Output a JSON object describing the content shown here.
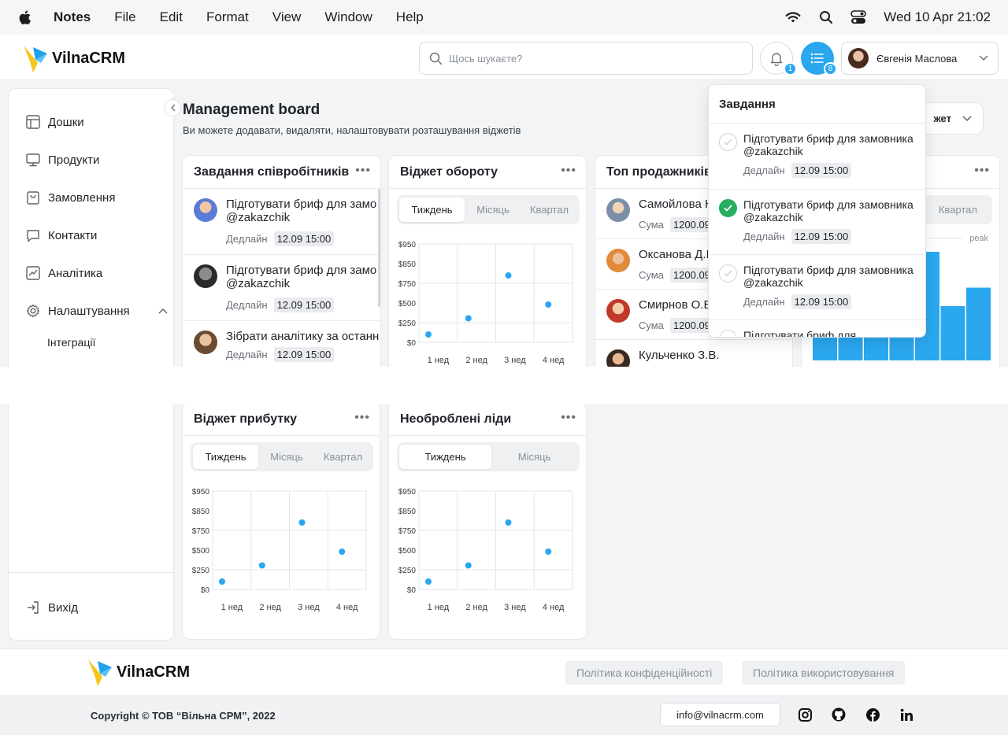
{
  "menubar": {
    "app": "Notes",
    "items": [
      "File",
      "Edit",
      "Format",
      "View",
      "Window",
      "Help"
    ],
    "datetime": "Wed 10 Apr  21:02"
  },
  "header": {
    "logo_text": "VilnaCRM",
    "search_placeholder": "Щось шукаєте?",
    "notifications_count": "1",
    "tasks_count": "8",
    "user_name": "Євгенія Маслова"
  },
  "sidebar": {
    "items": [
      {
        "label": "Дошки",
        "icon": "board-icon"
      },
      {
        "label": "Продукти",
        "icon": "monitor-icon"
      },
      {
        "label": "Замовлення",
        "icon": "shopping-bag-icon"
      },
      {
        "label": "Контакти",
        "icon": "chat-icon"
      },
      {
        "label": "Аналітика",
        "icon": "chart-icon"
      },
      {
        "label": "Налаштування",
        "icon": "gear-icon"
      }
    ],
    "sub_item": "Інтеграції",
    "logout": "Вихід"
  },
  "page": {
    "title": "Management board",
    "subtitle": "Ви можете додавати, видаляти, налаштовувати розташування віджетів",
    "add_widget_label": "жет"
  },
  "employee_tasks": {
    "title": "Завдання співробітників",
    "tasks": [
      {
        "text": "Підготувати бриф для замо",
        "handle": "@zakazchik",
        "deadline_label": "Дедлайн",
        "deadline": "12.09 15:00"
      },
      {
        "text": "Підготувати бриф для замо",
        "handle": "@zakazchik",
        "deadline_label": "Дедлайн",
        "deadline": "12.09 15:00"
      },
      {
        "text": "Зібрати аналітику за останн",
        "handle": "",
        "deadline_label": "Дедлайн",
        "deadline": "12.09 15:00"
      }
    ]
  },
  "turnover": {
    "title": "Віджет обороту",
    "tabs": [
      "Тиждень",
      "Місяць",
      "Квартал"
    ]
  },
  "top_sellers": {
    "title": "Топ продажників",
    "sum_label": "Сума",
    "sellers": [
      {
        "name": "Самойлова Н",
        "sum": "1200.09"
      },
      {
        "name": "Оксанова Д.І",
        "sum": "1200.09"
      },
      {
        "name": "Смирнов О.В",
        "sum": "1200.09"
      },
      {
        "name": "Кульченко З.В.",
        "sum": ""
      }
    ]
  },
  "right_widget": {
    "tab": "Квартал",
    "peak_label": "peak"
  },
  "profit": {
    "title": "Віджет прибутку",
    "tabs": [
      "Тиждень",
      "Місяць",
      "Квартал"
    ]
  },
  "leads": {
    "title": "Необроблені ліди",
    "tabs": [
      "Тиждень",
      "Місяць"
    ]
  },
  "tasks_dropdown": {
    "title": "Завдання",
    "items": [
      {
        "text": "Підготувати бриф для замовника @zakazchik",
        "deadline_label": "Дедлайн",
        "deadline": "12.09 15:00",
        "done": false
      },
      {
        "text": "Підготувати бриф для замовника @zakazchik",
        "deadline_label": "Дедлайн",
        "deadline": "12.09 15:00",
        "done": true
      },
      {
        "text": "Підготувати бриф для замовника @zakazchik",
        "deadline_label": "Дедлайн",
        "deadline": "12.09 15:00",
        "done": false
      },
      {
        "text": "Підготувати бриф для",
        "deadline_label": "",
        "deadline": "",
        "done": false
      }
    ]
  },
  "chart_data": [
    {
      "type": "scatter",
      "title": "",
      "y_ticks": [
        "$950",
        "$850",
        "$750",
        "$500",
        "$250",
        "$0"
      ],
      "categories": [
        "1 нед",
        "2 нед",
        "3 нед",
        "4 нед"
      ],
      "points": [
        {
          "x": "1 нед",
          "y": 100
        },
        {
          "x": "2 нед",
          "y": 305
        },
        {
          "x": "3 нед",
          "y": 790
        },
        {
          "x": "4 нед",
          "y": 480
        }
      ]
    },
    {
      "type": "scatter",
      "title": "",
      "y_ticks": [
        "$950",
        "$850",
        "$750",
        "$500",
        "$250",
        "$0"
      ],
      "categories": [
        "1 нед",
        "2 нед",
        "3 нед",
        "4 нед"
      ],
      "points": [
        {
          "x": "1 нед",
          "y": 100
        },
        {
          "x": "2 нед",
          "y": 305
        },
        {
          "x": "3 нед",
          "y": 790
        },
        {
          "x": "4 нед",
          "y": 480
        }
      ]
    },
    {
      "type": "scatter",
      "title": "",
      "y_ticks": [
        "$950",
        "$850",
        "$750",
        "$500",
        "$250",
        "$0"
      ],
      "categories": [
        "1 нед",
        "2 нед",
        "3 нед",
        "4 нед"
      ],
      "points": [
        {
          "x": "1 нед",
          "y": 100
        },
        {
          "x": "2 нед",
          "y": 305
        },
        {
          "x": "3 нед",
          "y": 790
        },
        {
          "x": "4 нед",
          "y": 480
        }
      ]
    },
    {
      "type": "bar",
      "title": "",
      "categories": [
        "",
        "",
        "",
        "",
        "",
        "",
        ""
      ],
      "values": [
        0.27,
        0.27,
        0.27,
        0.27,
        1.0,
        0.5,
        0.67
      ]
    }
  ],
  "footer": {
    "logo_text": "VilnaCRM",
    "privacy": "Політика конфіденційності",
    "terms": "Політика використовування",
    "copyright": "Copyright © ТОВ “Вільна СРМ”, 2022",
    "email": "info@vilnacrm.com"
  },
  "colors": {
    "accent": "#2aa7ee",
    "success": "#27ae60",
    "logo_yellow": "#f5c518",
    "logo_blue": "#1fa3e8"
  }
}
